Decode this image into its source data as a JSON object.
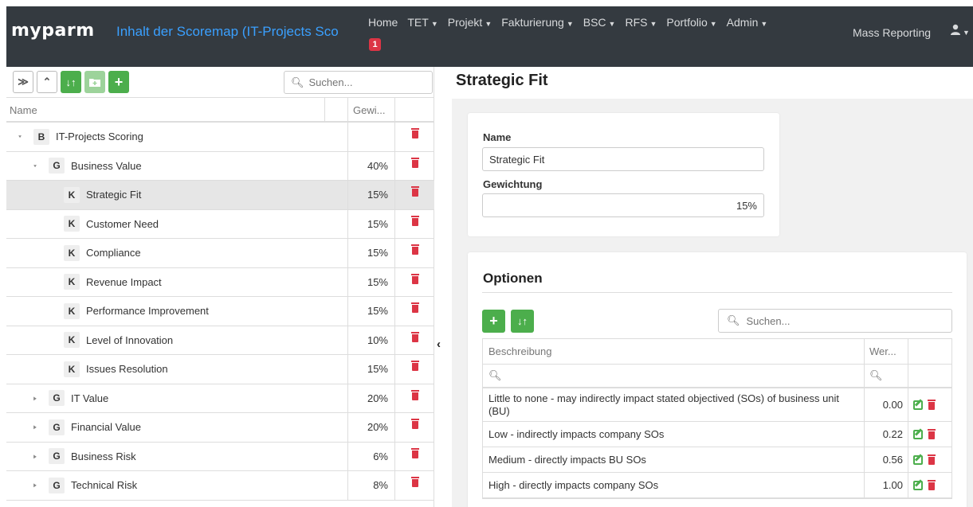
{
  "navbar": {
    "logo": "myparm",
    "subtitle": "Inhalt der Scoremap (IT-Projects Sco",
    "items": [
      {
        "label": "Home",
        "caret": false
      },
      {
        "label": "TET",
        "caret": true
      },
      {
        "label": "Projekt",
        "caret": true
      },
      {
        "label": "Fakturierung",
        "caret": true
      },
      {
        "label": "BSC",
        "caret": true
      },
      {
        "label": "RFS",
        "caret": true
      },
      {
        "label": "Portfolio",
        "caret": true
      },
      {
        "label": "Admin",
        "caret": true
      }
    ],
    "home_badge": "1",
    "mass_reporting": "Mass Reporting",
    "user_icon": "user-icon"
  },
  "tree": {
    "search_placeholder": "Suchen...",
    "col_name": "Name",
    "col_weight": "Gewi...",
    "rows": [
      {
        "level": 0,
        "expander": "open",
        "type": "B",
        "name": "IT-Projects Scoring",
        "weight": "",
        "selected": false
      },
      {
        "level": 1,
        "expander": "open",
        "type": "G",
        "name": "Business Value",
        "weight": "40%",
        "selected": false
      },
      {
        "level": 2,
        "expander": "",
        "type": "K",
        "name": "Strategic Fit",
        "weight": "15%",
        "selected": true
      },
      {
        "level": 2,
        "expander": "",
        "type": "K",
        "name": "Customer Need",
        "weight": "15%",
        "selected": false
      },
      {
        "level": 2,
        "expander": "",
        "type": "K",
        "name": "Compliance",
        "weight": "15%",
        "selected": false
      },
      {
        "level": 2,
        "expander": "",
        "type": "K",
        "name": "Revenue Impact",
        "weight": "15%",
        "selected": false
      },
      {
        "level": 2,
        "expander": "",
        "type": "K",
        "name": "Performance Improvement",
        "weight": "15%",
        "selected": false
      },
      {
        "level": 2,
        "expander": "",
        "type": "K",
        "name": "Level of Innovation",
        "weight": "10%",
        "selected": false
      },
      {
        "level": 2,
        "expander": "",
        "type": "K",
        "name": "Issues Resolution",
        "weight": "15%",
        "selected": false
      },
      {
        "level": 1,
        "expander": "closed",
        "type": "G",
        "name": "IT Value",
        "weight": "20%",
        "selected": false
      },
      {
        "level": 1,
        "expander": "closed",
        "type": "G",
        "name": "Financial Value",
        "weight": "20%",
        "selected": false
      },
      {
        "level": 1,
        "expander": "closed",
        "type": "G",
        "name": "Business Risk",
        "weight": "6%",
        "selected": false
      },
      {
        "level": 1,
        "expander": "closed",
        "type": "G",
        "name": "Technical Risk",
        "weight": "8%",
        "selected": false
      }
    ]
  },
  "detail": {
    "title": "Strategic Fit",
    "name_label": "Name",
    "name_value": "Strategic Fit",
    "weight_label": "Gewichtung",
    "weight_value": "15%"
  },
  "options": {
    "title": "Optionen",
    "search_placeholder": "Suchen...",
    "col_desc": "Beschreibung",
    "col_value": "Wer...",
    "rows": [
      {
        "desc": "Little to none - may indirectly impact stated objectived (SOs) of business unit (BU)",
        "value": "0.00"
      },
      {
        "desc": "Low - indirectly impacts company SOs",
        "value": "0.22"
      },
      {
        "desc": "Medium - directly impacts BU SOs",
        "value": "0.56"
      },
      {
        "desc": "High - directly impacts company SOs",
        "value": "1.00"
      }
    ]
  },
  "colors": {
    "navbar_bg": "#343a40",
    "subtitle": "#3aa0ff",
    "green": "#4cae4c",
    "danger": "#dc3545",
    "selected_row": "#e6e6e6"
  }
}
